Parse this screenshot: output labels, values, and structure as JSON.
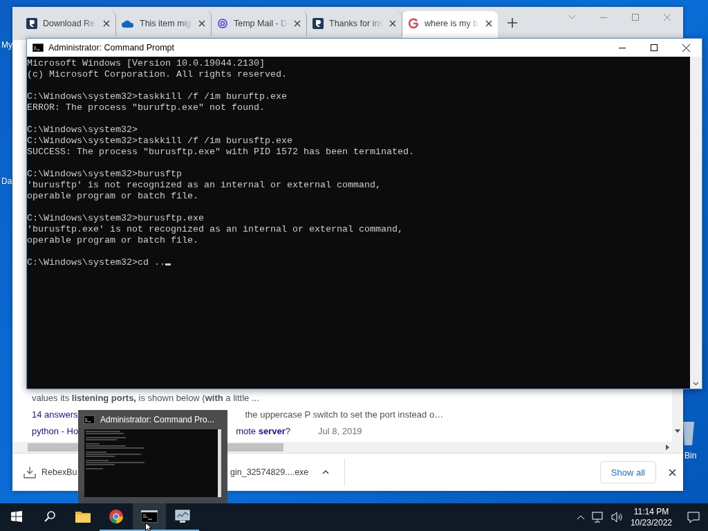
{
  "desktop": {
    "left_icons": [
      "My",
      "Da"
    ],
    "right_icons": [
      "Bin"
    ]
  },
  "browser": {
    "tabs": [
      {
        "title": "Download Re",
        "kind": "r",
        "selected": false
      },
      {
        "title": "This item mig",
        "kind": "cloud",
        "selected": false
      },
      {
        "title": "Temp Mail - D",
        "kind": "at",
        "selected": false
      },
      {
        "title": "Thanks for ins",
        "kind": "r",
        "selected": false
      },
      {
        "title": "where is my b",
        "kind": "g",
        "selected": true
      }
    ],
    "snippet": {
      "line_1": "values its **listening ports,** is shown below (**with** a little ...",
      "line_2_left": "14 answers",
      "line_2_right": "the uppercase P switch to set the port instead o…",
      "line_3_left": "python - Ho",
      "line_3_right": "mote **server**?",
      "date": "Jul 8, 2019"
    },
    "downloads": [
      {
        "name": "RebexBu"
      },
      {
        "name": "gin_32574829....exe"
      }
    ],
    "show_all": "Show all"
  },
  "cmd": {
    "title": "Administrator: Command Prompt",
    "blocks": [
      [
        "Microsoft Windows [Version 10.0.19044.2130]",
        "(c) Microsoft Corporation. All rights reserved."
      ],
      [
        "C:\\Windows\\system32>taskkill /f /im buruftp.exe",
        "ERROR: The process \"buruftp.exe\" not found."
      ],
      [
        "C:\\Windows\\system32>",
        "C:\\Windows\\system32>taskkill /f /im burusftp.exe",
        "SUCCESS: The process \"burusftp.exe\" with PID 1572 has been terminated."
      ],
      [
        "C:\\Windows\\system32>burusftp",
        "'burusftp' is not recognized as an internal or external command,",
        "operable program or batch file."
      ],
      [
        "C:\\Windows\\system32>burusftp.exe",
        "'burusftp.exe' is not recognized as an internal or external command,",
        "operable program or batch file."
      ],
      [
        "C:\\Windows\\system32>cd .."
      ]
    ]
  },
  "thumbnail": {
    "title": "Administrator: Command Pro..."
  },
  "taskbar": {
    "apps": [
      {
        "kind": "start",
        "running": false,
        "selected": false
      },
      {
        "kind": "search",
        "running": false,
        "selected": false
      },
      {
        "kind": "explorer",
        "running": false,
        "selected": false
      },
      {
        "kind": "chrome",
        "running": true,
        "selected": false
      },
      {
        "kind": "cmd",
        "running": true,
        "selected": true
      },
      {
        "kind": "monitor",
        "running": true,
        "selected": false
      }
    ],
    "time": "11:14 PM",
    "date": "10/23/2022"
  }
}
